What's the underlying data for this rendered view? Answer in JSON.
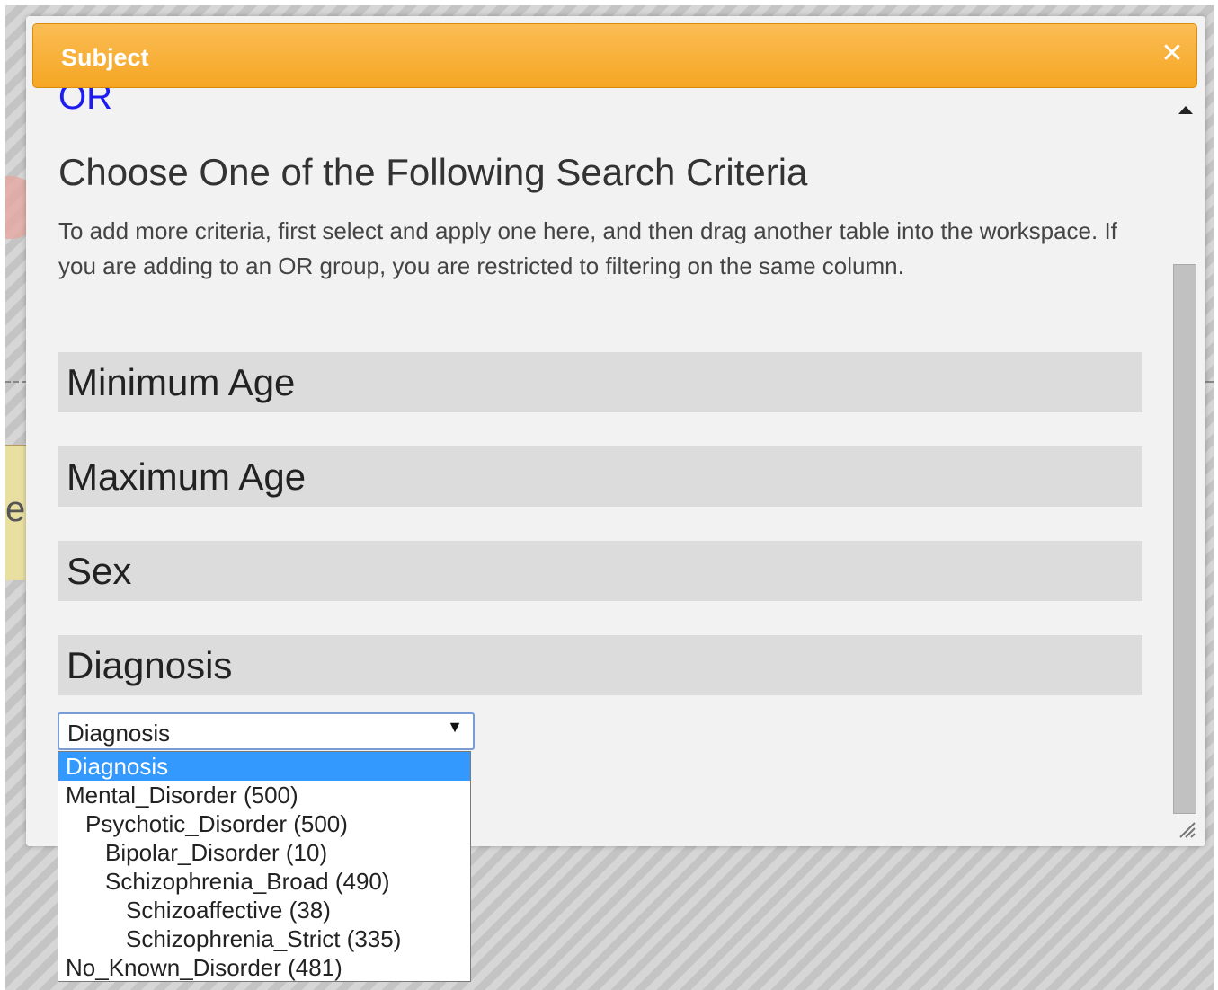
{
  "dialog": {
    "title": "Subject",
    "close_icon": "close-icon",
    "or_label": "OR",
    "heading": "Choose One of the Following Search Criteria",
    "description": "To add more criteria, first select and apply one here, and then drag another table into the workspace. If you are adding to an OR group, you are restricted to filtering on the same column."
  },
  "criteria": [
    {
      "label": "Minimum Age"
    },
    {
      "label": "Maximum Age"
    },
    {
      "label": "Sex"
    },
    {
      "label": "Diagnosis"
    }
  ],
  "diagnosis_select": {
    "value": "Diagnosis",
    "arrow_icon": "dropdown-arrow-icon",
    "options": [
      {
        "label": "Diagnosis",
        "selected": true
      },
      {
        "label": "Mental_Disorder (500)"
      },
      {
        "label": "Psychotic_Disorder (500)"
      },
      {
        "label": "Bipolar_Disorder (10)"
      },
      {
        "label": "Schizophrenia_Broad (490)"
      },
      {
        "label": "Schizoaffective (38)"
      },
      {
        "label": "Schizophrenia_Strict (335)"
      },
      {
        "label": "No_Known_Disorder (481)"
      }
    ]
  },
  "colors": {
    "titlebar": "#f5a623",
    "or_label": "#1c1cf0",
    "option_highlight": "#3399ff",
    "criteria_bg": "#dcdcdc"
  }
}
